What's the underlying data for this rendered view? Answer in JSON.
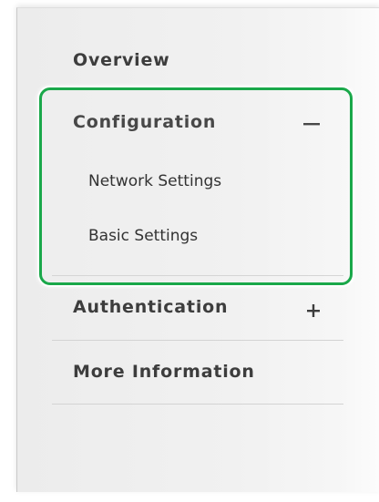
{
  "nav": {
    "overview": {
      "label": "Overview",
      "icon": ""
    },
    "configuration": {
      "label": "Configuration",
      "icon": "collapse-icon",
      "expanded": true,
      "children": [
        {
          "label": "Network Settings"
        },
        {
          "label": "Basic Settings"
        }
      ]
    },
    "authentication": {
      "label": "Authentication",
      "icon": "expand-icon",
      "expanded": false
    },
    "more_information": {
      "label": "More Information"
    }
  },
  "highlight": {
    "color": "#1aa84a"
  }
}
